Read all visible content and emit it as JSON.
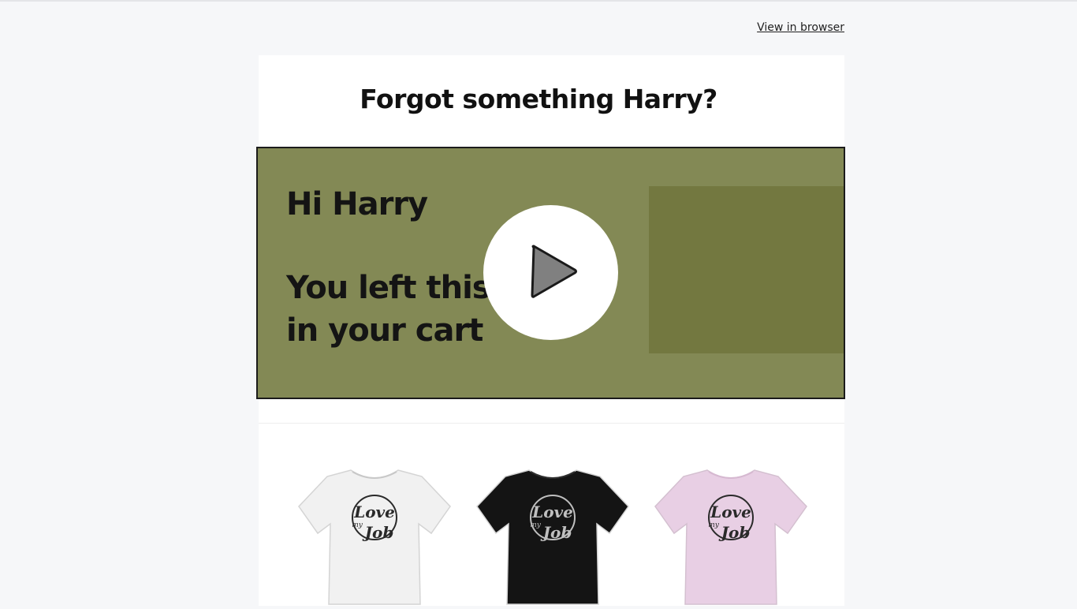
{
  "header": {
    "view_in_browser": "View in browser"
  },
  "email": {
    "headline": "Forgot something Harry?",
    "video": {
      "line1": "Hi Harry",
      "line2": "You left this",
      "line3": "in your cart",
      "play_icon": "play-icon",
      "colors": {
        "background": "#838955",
        "panel": "#737840",
        "text": "#141414"
      }
    },
    "products": [
      {
        "color_name": "white",
        "shirt_color": "#f1f1f1",
        "print_color": "#2a2a2a",
        "print_text_1": "Love",
        "print_text_2": "my",
        "print_text_3": "Job"
      },
      {
        "color_name": "black",
        "shirt_color": "#141414",
        "print_color": "#bfbfbf",
        "print_text_1": "Love",
        "print_text_2": "my",
        "print_text_3": "Job"
      },
      {
        "color_name": "pink",
        "shirt_color": "#e8cfe4",
        "print_color": "#2a2a2a",
        "print_text_1": "Love",
        "print_text_2": "my",
        "print_text_3": "Job"
      }
    ]
  }
}
